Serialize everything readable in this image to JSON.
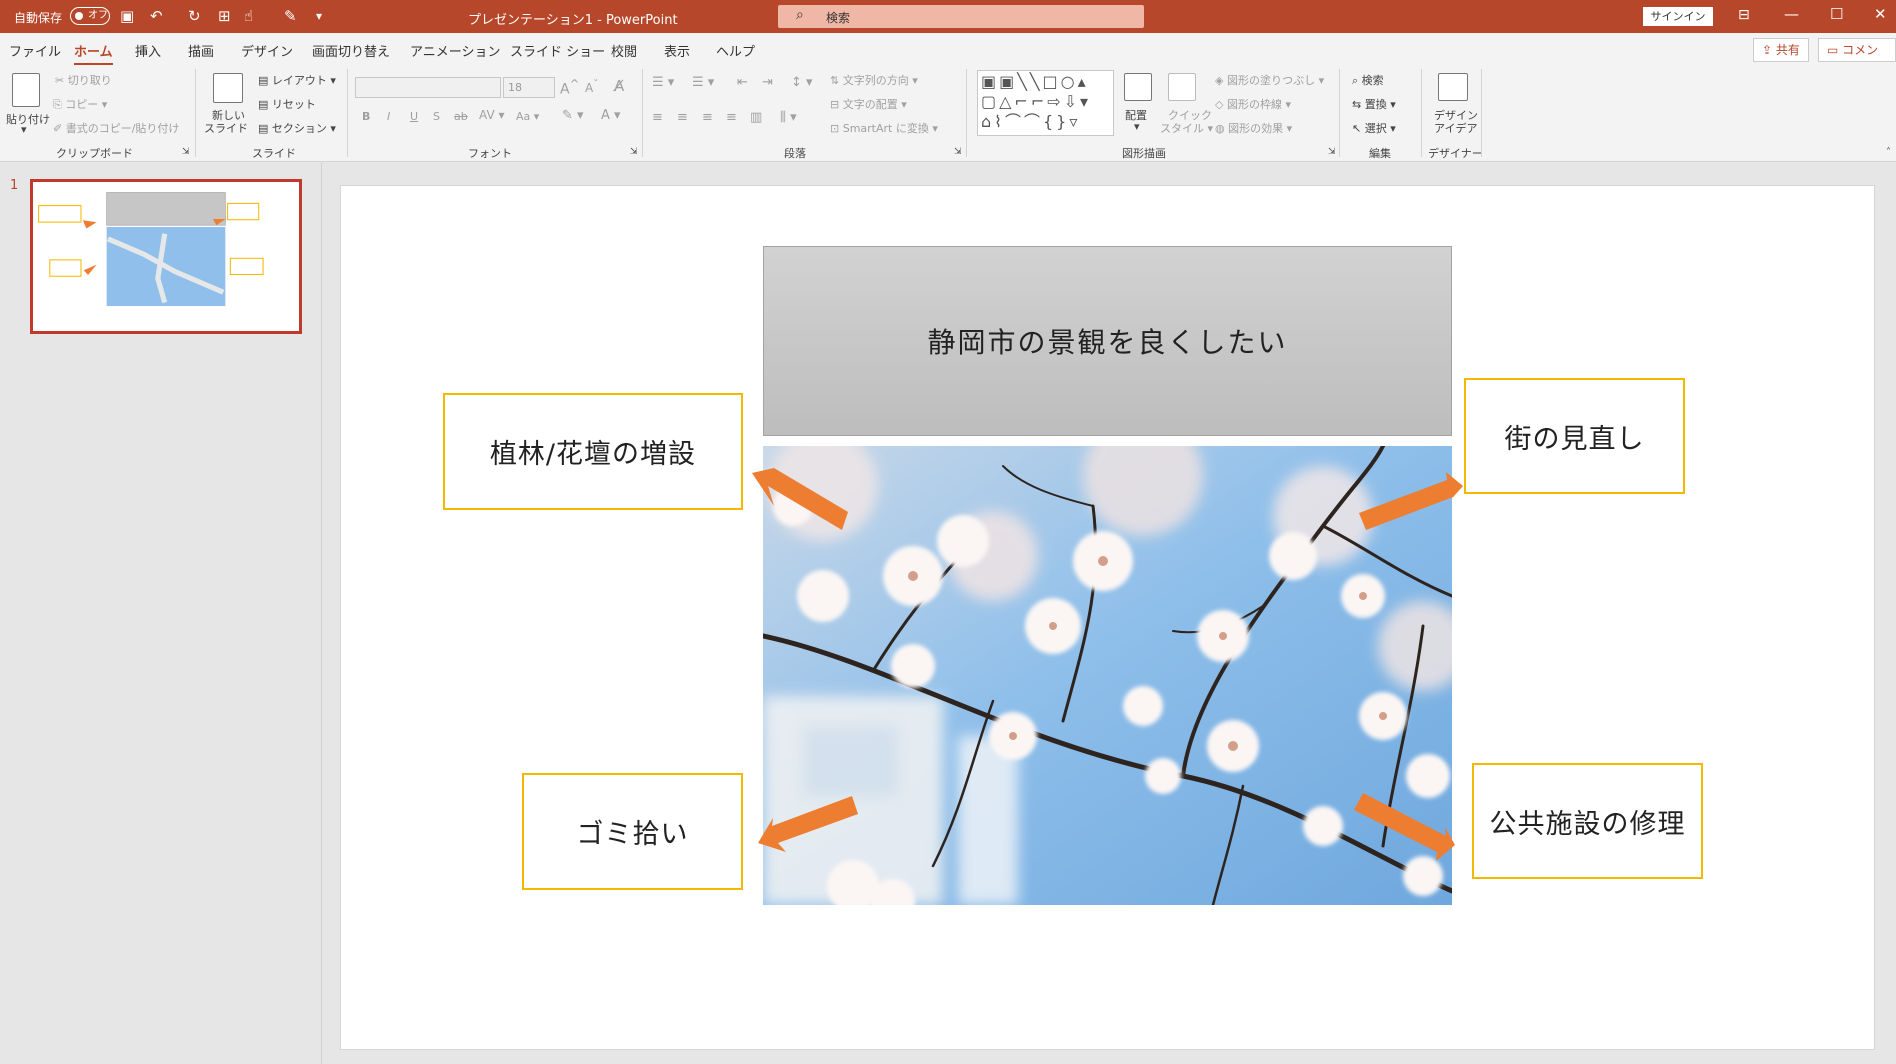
{
  "titlebar": {
    "autosave_label": "自動保存",
    "autosave_state": "オフ",
    "document_title": "プレゼンテーション1 - PowerPoint",
    "search_placeholder": "検索",
    "signin_label": "サインイン"
  },
  "menu_tabs": [
    "ファイル",
    "ホーム",
    "挿入",
    "描画",
    "デザイン",
    "画面切り替え",
    "アニメーション",
    "スライド ショー",
    "校閲",
    "表示",
    "ヘルプ"
  ],
  "active_tab": "ホーム",
  "share_label": "共有",
  "comment_label": "コメント",
  "ribbon": {
    "clipboard": {
      "paste": "貼り付け",
      "cut": "切り取り",
      "copy": "コピー",
      "format_painter": "書式のコピー/貼り付け",
      "group": "クリップボード"
    },
    "slides": {
      "new_slide_1": "新しい",
      "new_slide_2": "スライド",
      "layout": "レイアウト",
      "reset": "リセット",
      "section": "セクション",
      "group": "スライド"
    },
    "font": {
      "size": "18",
      "group": "フォント"
    },
    "paragraph": {
      "text_direction": "文字列の方向",
      "align_text": "文字の配置",
      "smartart": "SmartArt に変換",
      "group": "段落"
    },
    "drawing": {
      "arrange": "配置",
      "quick_styles_1": "クイック",
      "quick_styles_2": "スタイル",
      "shape_fill": "図形の塗りつぶし",
      "shape_outline": "図形の枠線",
      "shape_effects": "図形の効果",
      "group": "図形描画"
    },
    "editing": {
      "find": "検索",
      "replace": "置換",
      "select": "選択",
      "group": "編集"
    },
    "designer": {
      "ideas_1": "デザイン",
      "ideas_2": "アイデア",
      "group": "デザイナー"
    }
  },
  "slide_panel": {
    "slide_number": "1"
  },
  "slide": {
    "title": "静岡市の景観を良くしたい",
    "callouts": {
      "top_left": "植林/花壇の増設",
      "top_right": "街の見直し",
      "bottom_left": "ゴミ拾い",
      "bottom_right": "公共施設の修理"
    }
  },
  "colors": {
    "accent": "#b7472a",
    "callout_border": "#f5b800",
    "arrow": "#ed7d31",
    "sky": "#8fbfea"
  }
}
